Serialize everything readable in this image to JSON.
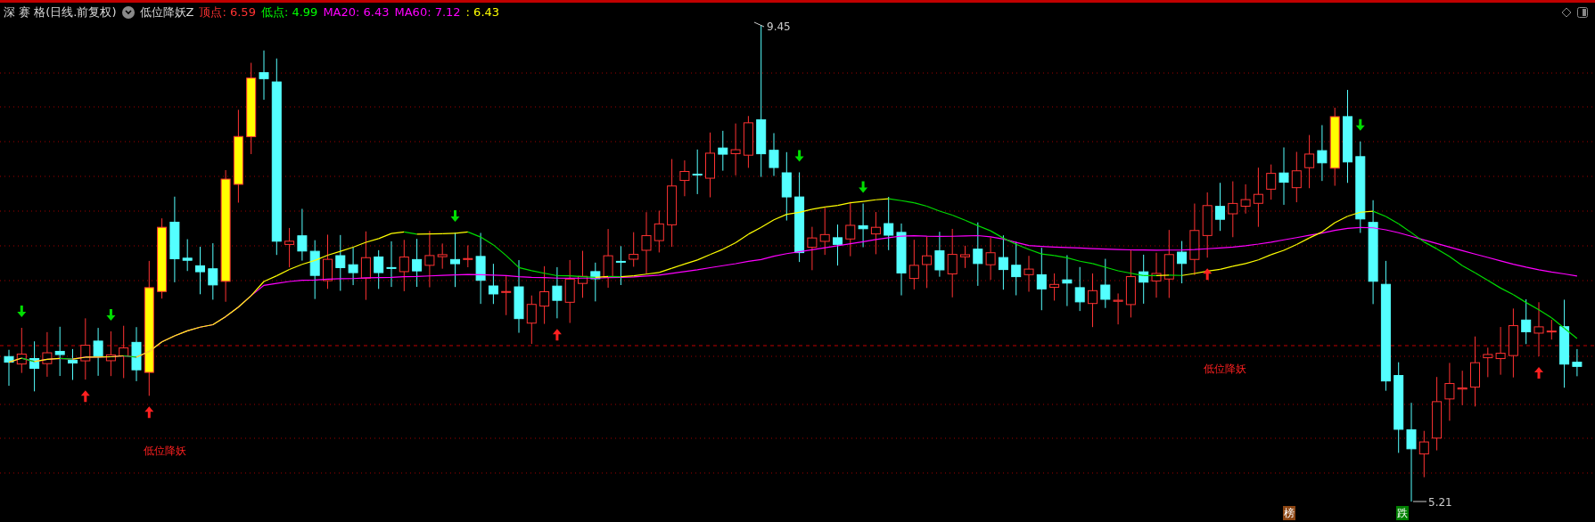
{
  "header": {
    "security": "深 赛 格(日线.前复权)",
    "indicator": "低位降妖Z",
    "legend": [
      {
        "text": "顶点: 6.59",
        "color": "#ff3232"
      },
      {
        "text": "低点: 4.99",
        "color": "#00ff00"
      },
      {
        "text": "MA20: 6.43",
        "color": "#ff00ff"
      },
      {
        "text": "MA60: 7.12",
        "color": "#ff00ff"
      },
      {
        "text": ": 6.43",
        "color": "#ffff00"
      }
    ]
  },
  "chart": {
    "high_label": "9.45",
    "low_label": "5.21",
    "signal_labels": [
      "低位降妖",
      "低位降妖"
    ],
    "markers": [
      {
        "text": "榜",
        "color": "#8b4513"
      },
      {
        "text": "跌",
        "color": "#008000"
      }
    ]
  }
}
